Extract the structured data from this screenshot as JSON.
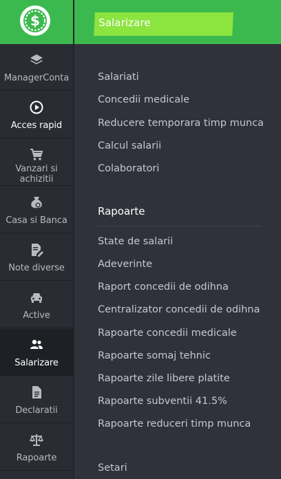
{
  "header": {
    "title": "Salarizare",
    "brand_color": "#3cb94e",
    "highlight_color": "#8ce43f",
    "logo_icon": "dollar-coin-icon"
  },
  "sidebar": {
    "items": [
      {
        "label": "ManagerConta",
        "icon": "layers-icon",
        "active": false
      },
      {
        "label": "Acces rapid",
        "icon": "play-circle-icon",
        "active": false
      },
      {
        "label": "Vanzari si achizitii",
        "icon": "shopping-cart-icon",
        "active": false
      },
      {
        "label": "Casa si Banca",
        "icon": "money-bag-icon",
        "active": false
      },
      {
        "label": "Note diverse",
        "icon": "note-edit-icon",
        "active": false
      },
      {
        "label": "Active",
        "icon": "car-icon",
        "active": false
      },
      {
        "label": "Salarizare",
        "icon": "people-icon",
        "active": true
      },
      {
        "label": "Declaratii",
        "icon": "document-icon",
        "active": false
      },
      {
        "label": "Rapoarte",
        "icon": "scale-icon",
        "active": false
      }
    ]
  },
  "main": {
    "links": [
      "Salariati",
      "Concedii medicale",
      "Reducere temporara timp munca",
      "Calcul salarii",
      "Colaboratori"
    ],
    "reports_heading": "Rapoarte",
    "reports": [
      "State de salarii",
      "Adeverinte",
      "Raport concedii de odihna",
      "Centralizator concedii de odihna",
      "Rapoarte concedii medicale",
      "Rapoarte somaj tehnic",
      "Rapoarte zile libere platite",
      "Rapoarte subventii 41.5%",
      "Rapoarte reduceri timp munca"
    ],
    "settings_label": "Setari"
  }
}
